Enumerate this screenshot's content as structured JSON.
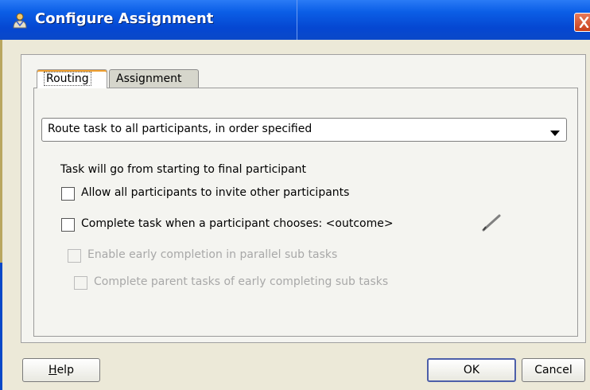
{
  "window": {
    "title": "Configure Assignment",
    "icon": "settings-person-icon",
    "close_icon": "close-icon"
  },
  "tabs": [
    {
      "label": "Routing",
      "active": true
    },
    {
      "label": "Assignment",
      "active": false
    }
  ],
  "routing": {
    "route_select": {
      "selected": "Route task to all participants, in order specified",
      "arrow_icon": "chevron-down-icon"
    },
    "description": "Task will go from starting to final participant",
    "options": [
      {
        "label": "Allow all participants to invite other participants",
        "checked": false,
        "enabled": true
      },
      {
        "label": "Complete task when a participant chooses: <outcome>",
        "checked": false,
        "enabled": true
      },
      {
        "label": "Enable early completion in parallel sub tasks",
        "checked": false,
        "enabled": false
      },
      {
        "label": "Complete parent tasks of early completing sub tasks",
        "checked": false,
        "enabled": false
      }
    ],
    "edit_icon": "pencil-icon"
  },
  "buttons": {
    "help_mnemonic": "H",
    "help_rest": "elp",
    "ok": "OK",
    "cancel": "Cancel"
  },
  "colors": {
    "title_bar": "#0a48c8",
    "dialog_bg": "#ece9d8",
    "disabled_text": "#a8a8a8",
    "active_tab_accent": "#f0a030"
  }
}
